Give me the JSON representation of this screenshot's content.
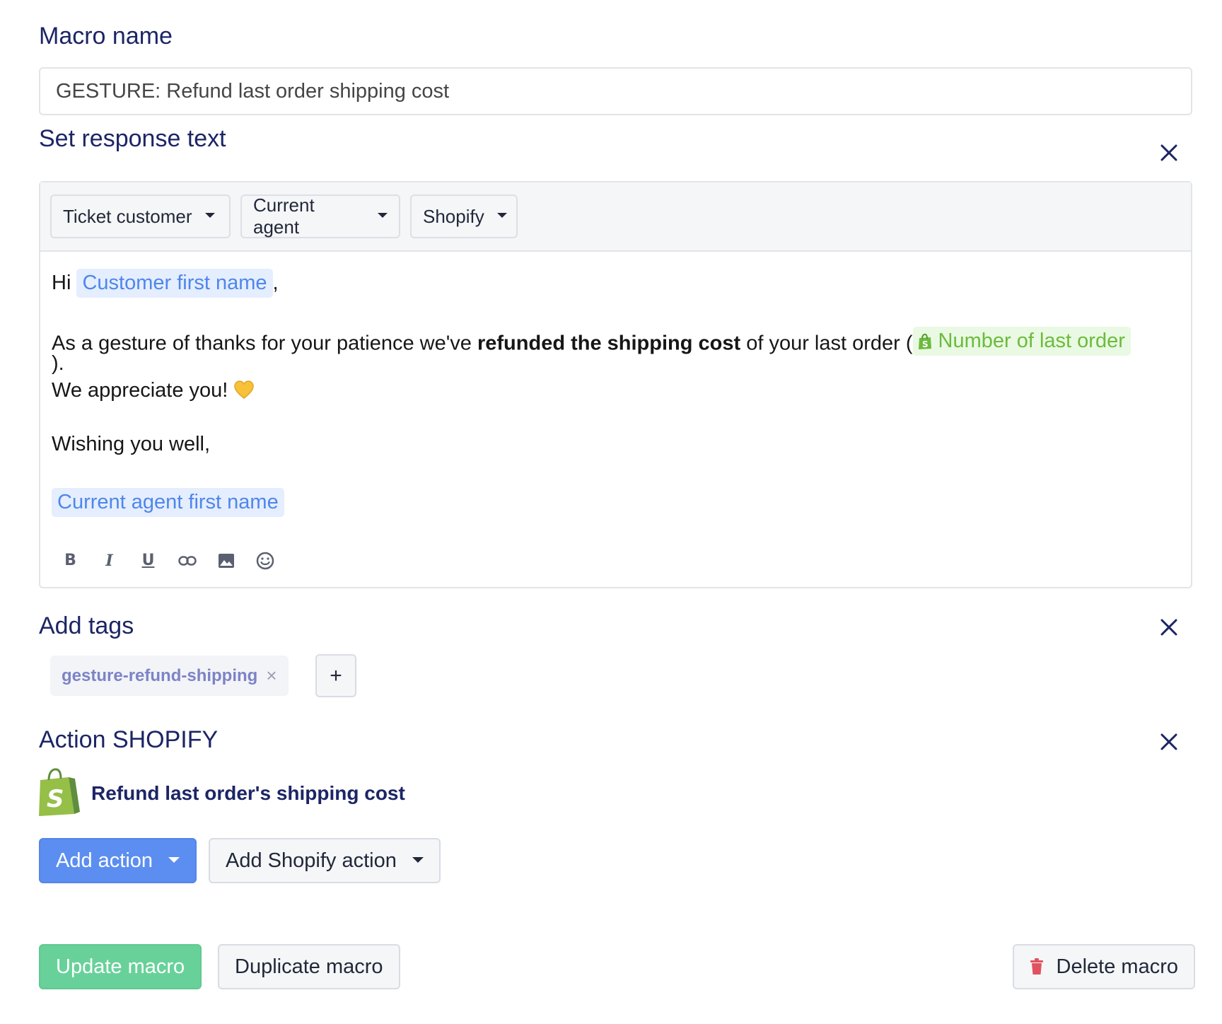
{
  "macro_name": {
    "label": "Macro name",
    "value": "GESTURE: Refund last order shipping cost"
  },
  "response": {
    "title": "Set response text",
    "variable_menus": [
      "Ticket customer",
      "Current agent",
      "Shopify"
    ],
    "body": {
      "greeting": "Hi",
      "customer_var": "Customer first name",
      "comma": ",",
      "line2_pre": "As a gesture of thanks for your patience we've ",
      "line2_bold": "refunded the shipping cost",
      "line2_post": " of your last order (",
      "order_var": "Number of last order",
      "line2_close": ").",
      "line3": "We appreciate you! ",
      "line4": "Wishing you well,",
      "agent_var": "Current agent first name"
    },
    "format_tools": [
      "bold-icon",
      "italic-icon",
      "underline-icon",
      "link-icon",
      "image-icon",
      "emoji-icon"
    ]
  },
  "tags": {
    "title": "Add tags",
    "items": [
      "gesture-refund-shipping"
    ],
    "add_label": "+"
  },
  "shopify_action": {
    "title": "Action SHOPIFY",
    "action_label": "Refund last order's shipping cost"
  },
  "action_buttons": {
    "add_action": "Add action",
    "add_shopify_action": "Add Shopify action"
  },
  "footer": {
    "update": "Update macro",
    "duplicate": "Duplicate macro",
    "delete": "Delete macro"
  },
  "colors": {
    "heading": "#1c2565",
    "primary": "#5b8ef0",
    "success": "#68d19a",
    "variable_blue": "#4f86ec",
    "variable_green": "#6cbb3c",
    "danger": "#e0525f"
  }
}
